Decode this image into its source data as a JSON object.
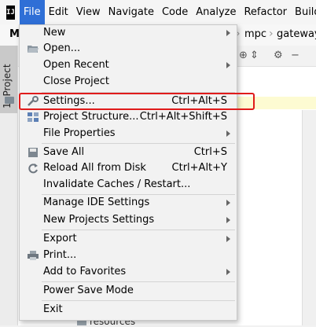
{
  "menubar": {
    "app_icon": "IJ",
    "items": [
      {
        "label": "File",
        "active": true
      },
      {
        "label": "Edit"
      },
      {
        "label": "View"
      },
      {
        "label": "Navigate"
      },
      {
        "label": "Code"
      },
      {
        "label": "Analyze"
      },
      {
        "label": "Refactor"
      },
      {
        "label": "Build"
      }
    ]
  },
  "navbar": {
    "project_short": "MF",
    "crumbs": [
      "mpc",
      "gateway"
    ]
  },
  "tool_window": {
    "tab_label": "1: Project"
  },
  "project_tree": {
    "visible_item": "resources"
  },
  "file_menu": {
    "items": [
      {
        "label": "New",
        "icon": "",
        "shortcut": "",
        "submenu": true
      },
      {
        "label": "Open...",
        "icon": "folder-open-icon",
        "shortcut": "",
        "submenu": false
      },
      {
        "label": "Open Recent",
        "icon": "",
        "shortcut": "",
        "submenu": true
      },
      {
        "label": "Close Project",
        "icon": "",
        "shortcut": "",
        "submenu": false
      },
      {
        "label": "Settings...",
        "icon": "wrench-icon",
        "shortcut": "Ctrl+Alt+S",
        "submenu": false
      },
      {
        "label": "Project Structure...",
        "icon": "project-structure-icon",
        "shortcut": "Ctrl+Alt+Shift+S",
        "submenu": false
      },
      {
        "label": "File Properties",
        "icon": "",
        "shortcut": "",
        "submenu": true
      },
      {
        "label": "Save All",
        "icon": "save-icon",
        "shortcut": "Ctrl+S",
        "submenu": false
      },
      {
        "label": "Reload All from Disk",
        "icon": "reload-icon",
        "shortcut": "Ctrl+Alt+Y",
        "submenu": false
      },
      {
        "label": "Invalidate Caches / Restart...",
        "icon": "",
        "shortcut": "",
        "submenu": false
      },
      {
        "label": "Manage IDE Settings",
        "icon": "",
        "shortcut": "",
        "submenu": true
      },
      {
        "label": "New Projects Settings",
        "icon": "",
        "shortcut": "",
        "submenu": true
      },
      {
        "label": "Export",
        "icon": "",
        "shortcut": "",
        "submenu": true
      },
      {
        "label": "Print...",
        "icon": "print-icon",
        "shortcut": "",
        "submenu": false
      },
      {
        "label": "Add to Favorites",
        "icon": "",
        "shortcut": "",
        "submenu": true
      },
      {
        "label": "Power Save Mode",
        "icon": "",
        "shortcut": "",
        "submenu": false
      },
      {
        "label": "Exit",
        "icon": "",
        "shortcut": "",
        "submenu": false
      }
    ]
  },
  "colors": {
    "menu_active": "#2f6fd6",
    "annotation_box": "#e01b1b"
  }
}
